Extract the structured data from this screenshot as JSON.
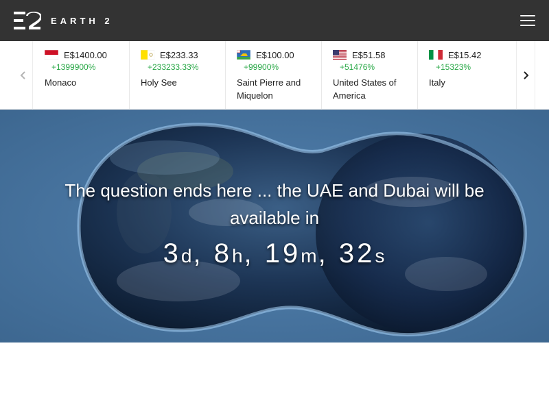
{
  "header": {
    "logo_text": "EARTH 2",
    "menu_icon": "hamburger-menu-icon"
  },
  "ticker": {
    "prev_icon": "chevron-left-icon",
    "next_icon": "chevron-right-icon",
    "cards": [
      {
        "price": "E$1400.00",
        "change": "+1399900%",
        "country": "Monaco",
        "flag": "monaco-flag-icon"
      },
      {
        "price": "E$233.33",
        "change": "+233233.33%",
        "country": "Holy See",
        "flag": "holy-see-flag-icon"
      },
      {
        "price": "E$100.00",
        "change": "+99900%",
        "country": "Saint Pierre and Miquelon",
        "flag": "saint-pierre-flag-icon"
      },
      {
        "price": "E$51.58",
        "change": "+51476%",
        "country": "United States of America",
        "flag": "usa-flag-icon"
      },
      {
        "price": "E$15.42",
        "change": "+15323%",
        "country": "Italy",
        "flag": "italy-flag-icon"
      }
    ]
  },
  "hero": {
    "title": "The question ends here ... the UAE and Dubai will be available in",
    "countdown": {
      "days": "3",
      "days_unit": "d",
      "hours": "8",
      "hours_unit": "h",
      "minutes": "19",
      "minutes_unit": "m",
      "seconds": "32",
      "seconds_unit": "s"
    }
  },
  "colors": {
    "header_bg": "#333333",
    "positive_change": "#27a745"
  }
}
